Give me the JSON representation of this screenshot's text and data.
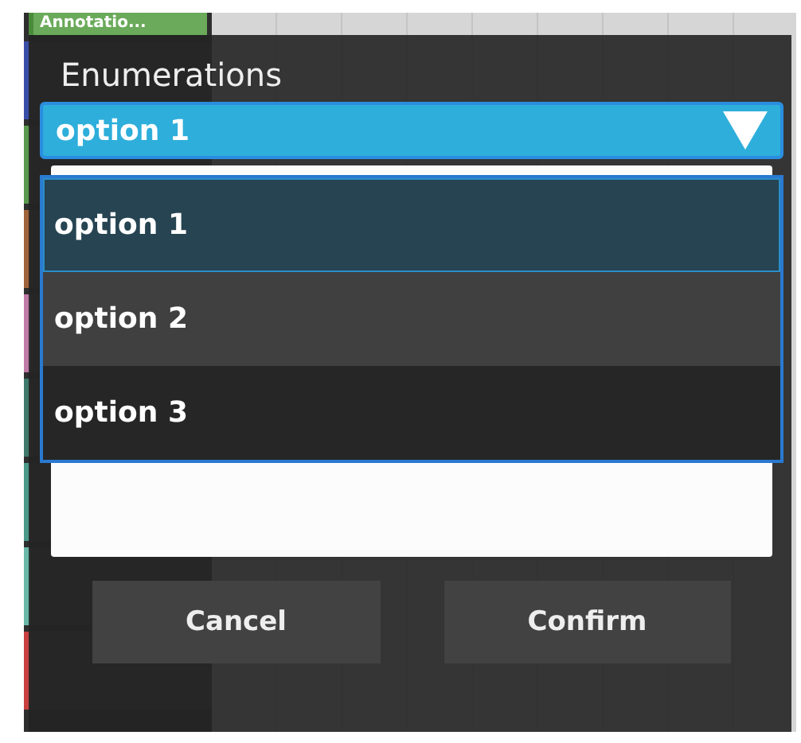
{
  "background": {
    "header": "Annotatio...",
    "annotations": [
      {
        "color": "#3a4ea8"
      },
      {
        "color": "#5a9a4e"
      },
      {
        "color": "#a0643a"
      },
      {
        "color": "#c07aa8"
      },
      {
        "color": "#3e7a6c"
      },
      {
        "color": "#4a9a8a"
      },
      {
        "color": "#6ab8a8"
      },
      {
        "color": "#c84040"
      }
    ]
  },
  "dialog": {
    "title": "Enumerations",
    "dropdown": {
      "value": "option 1",
      "expanded": true,
      "options": [
        {
          "label": "option 1",
          "selected": true,
          "hovered": false
        },
        {
          "label": "option 2",
          "selected": false,
          "hovered": true
        },
        {
          "label": "option 3",
          "selected": false,
          "hovered": false
        }
      ]
    },
    "buttons": [
      {
        "label": "Cancel"
      },
      {
        "label": "Confirm"
      }
    ]
  }
}
